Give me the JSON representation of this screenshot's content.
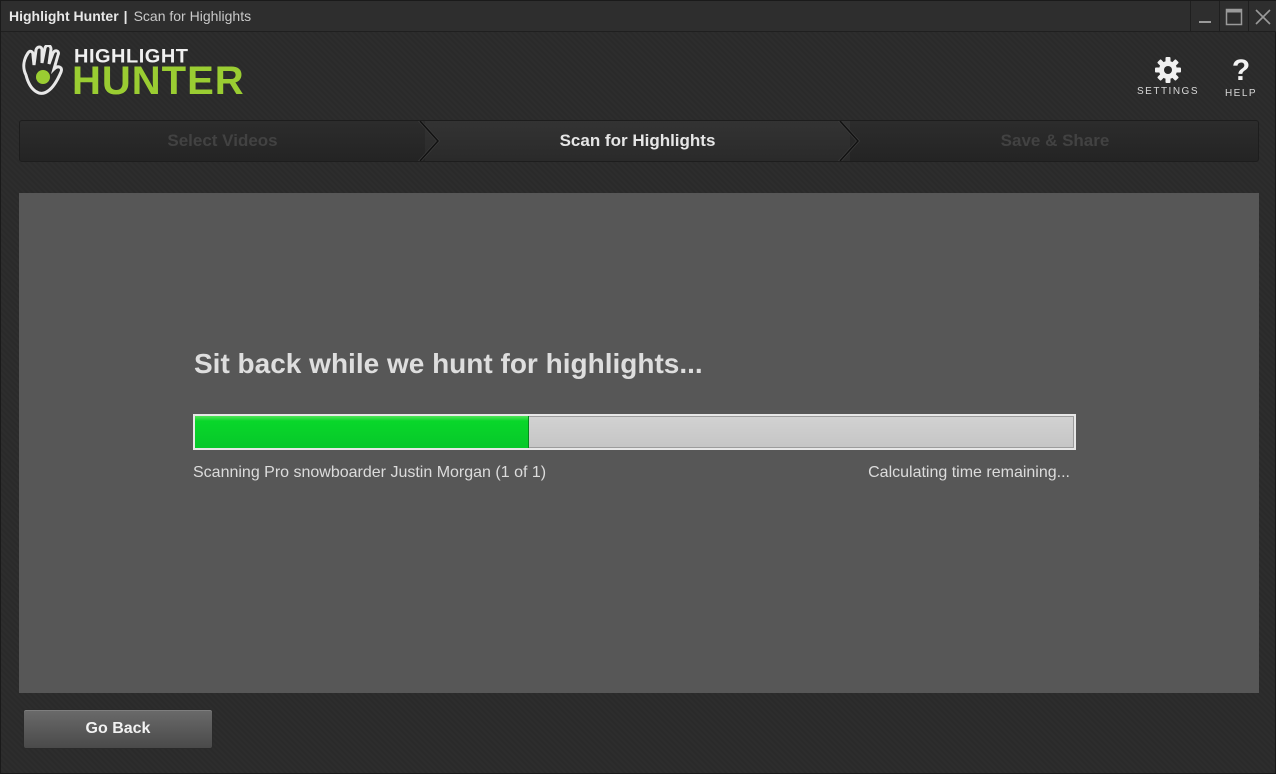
{
  "window": {
    "app_name": "Highlight Hunter",
    "separator": "|",
    "page_name": "Scan for Highlights",
    "controls": [
      "minimize-icon",
      "maximize-icon",
      "close-icon"
    ]
  },
  "logo": {
    "line1": "HIGHLIGHT",
    "line2": "HUNTER",
    "accent_color": "#9acd32"
  },
  "header": {
    "settings_label": "SETTINGS",
    "settings_icon": "gear-icon",
    "help_label": "HELP",
    "help_icon": "question-mark-icon",
    "help_glyph": "?"
  },
  "steps": [
    {
      "label": "Select Videos",
      "state": "inactive"
    },
    {
      "label": "Scan for Highlights",
      "state": "active"
    },
    {
      "label": "Save & Share",
      "state": "inactive"
    }
  ],
  "scan": {
    "headline": "Sit back while we hunt for highlights...",
    "progress_fraction": 0.38,
    "progress_color": "#06c82a",
    "status": "Scanning Pro snowboarder Justin Morgan (1 of 1)",
    "time_remaining": "Calculating time remaining..."
  },
  "footer": {
    "go_back_label": "Go Back"
  }
}
